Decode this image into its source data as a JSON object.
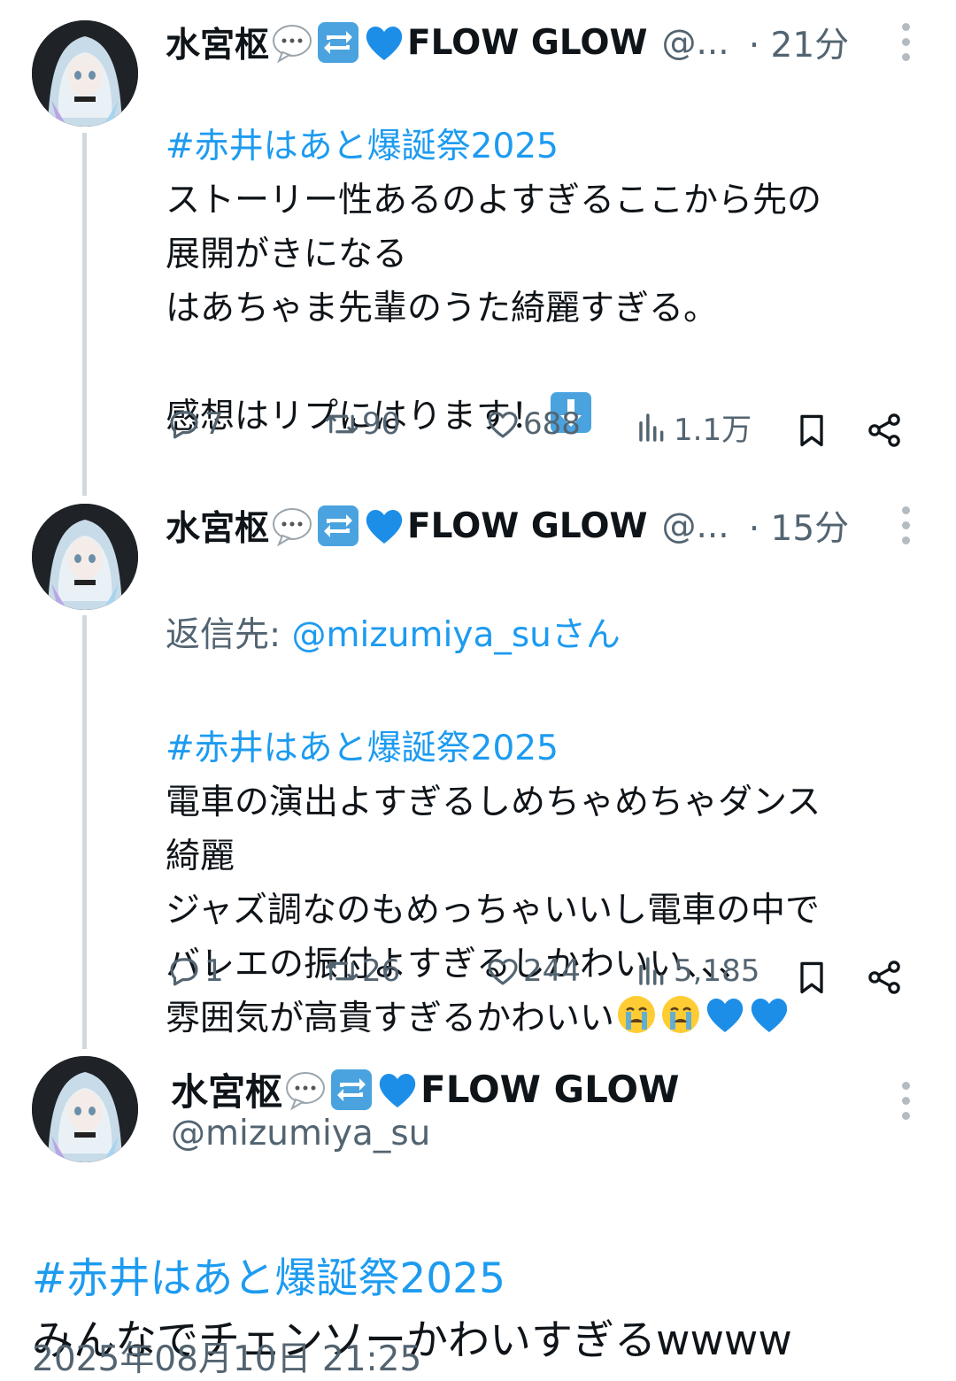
{
  "tweets": [
    {
      "name": "水宮枢",
      "name_suffix": "FLOW GLOW",
      "handle": "@...",
      "time": "· 21分",
      "hashtag": "#赤井はあと爆誕祭2025",
      "text": "ストーリー性あるのよすぎるここから先の\n展開がきになる\nはあちゃま先輩のうた綺麗すぎる。\n\n感想はリプにはります！",
      "stats": {
        "replies": "7",
        "retweets": "90",
        "likes": "688",
        "views": "1.1万"
      }
    },
    {
      "name": "水宮枢",
      "name_suffix": "FLOW GLOW",
      "handle": "@...",
      "time": "· 15分",
      "reply_to_label": "返信先: ",
      "reply_to_user": "@mizumiya_suさん",
      "hashtag": "#赤井はあと爆誕祭2025",
      "text": "電車の演出よすぎるしめちゃめちゃダンス\n綺麗\nジャズ調なのもめっちゃいいし電車の中で\nバレエの振付よすぎるしかわいい、、、\n雰囲気が高貴すぎるかわいい",
      "stats": {
        "replies": "1",
        "retweets": "26",
        "likes": "244",
        "views": "5,185"
      }
    }
  ],
  "main": {
    "name": "水宮枢",
    "name_suffix": "FLOW GLOW",
    "handle": "@mizumiya_su",
    "hashtag": "#赤井はあと爆誕祭2025",
    "text": "みんなでチェンソーかわいすぎるwwww",
    "timestamp": "2025年08月10日 21:25"
  },
  "icons": {
    "speech": "speech-bubble-icon",
    "repeat": "repeat-icon",
    "heart": "blue-heart-icon",
    "down": "down-arrow-icon",
    "cry": "crying-face-icon"
  },
  "colors": {
    "accent": "#1d9bf0",
    "muted": "#536471",
    "text": "#0f1419"
  }
}
